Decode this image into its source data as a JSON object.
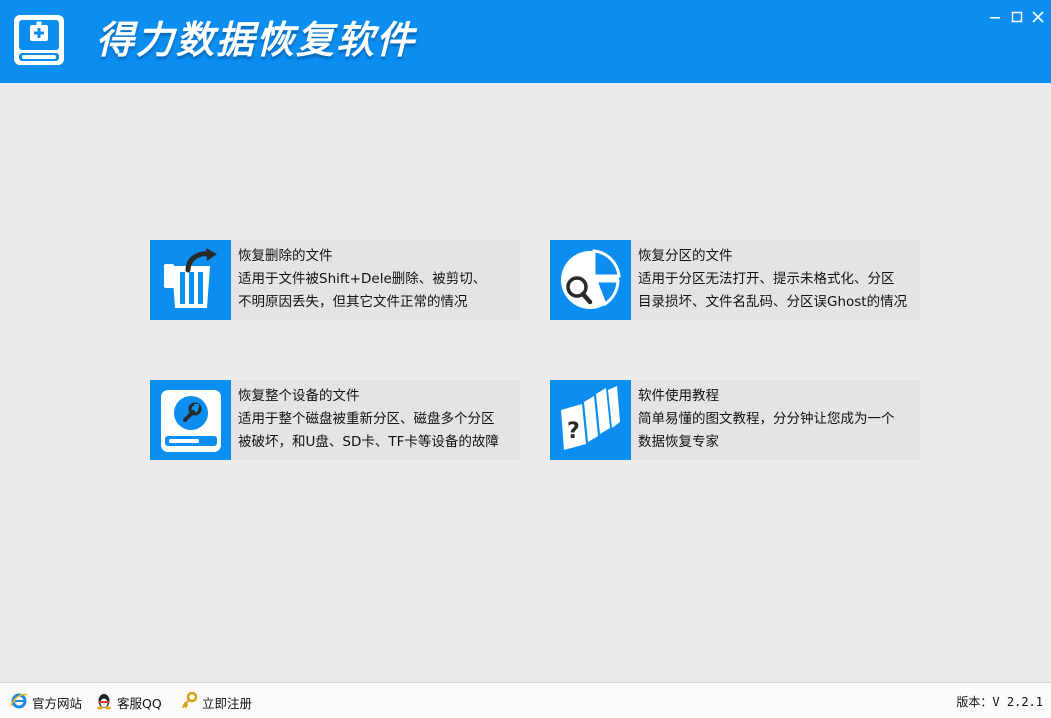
{
  "app": {
    "title": "得力数据恢复软件",
    "logo_icon": "hard-drive-medical-icon",
    "accent_color": "#0b8ef0"
  },
  "window_controls": {
    "minimize_icon": "minimize-icon",
    "maximize_icon": "maximize-icon",
    "close_icon": "close-icon"
  },
  "cards": [
    {
      "title": "恢复删除的文件",
      "desc1": "适用于文件被Shift+Dele删除、被剪切、",
      "desc2": "不明原因丢失，但其它文件正常的情况",
      "icon": "recycle-bin-restore-icon"
    },
    {
      "title": "恢复分区的文件",
      "desc1": "适用于分区无法打开、提示未格式化、分区",
      "desc2": "目录损坏、文件名乱码、分区误Ghost的情况",
      "icon": "partition-search-icon"
    },
    {
      "title": "恢复整个设备的文件",
      "desc1": "适用于整个磁盘被重新分区、磁盘多个分区",
      "desc2": "被破坏，和U盘、SD卡、TF卡等设备的故障",
      "icon": "disk-repair-icon"
    },
    {
      "title": "软件使用教程",
      "desc1": "简单易懂的图文教程，分分钟让您成为一个",
      "desc2": "数据恢复专家",
      "icon": "tutorial-help-icon"
    }
  ],
  "statusbar": {
    "website_label": "官方网站",
    "qq_label": "客服QQ",
    "register_label": "立即注册",
    "version_label": "版本：V 2.2.1"
  }
}
